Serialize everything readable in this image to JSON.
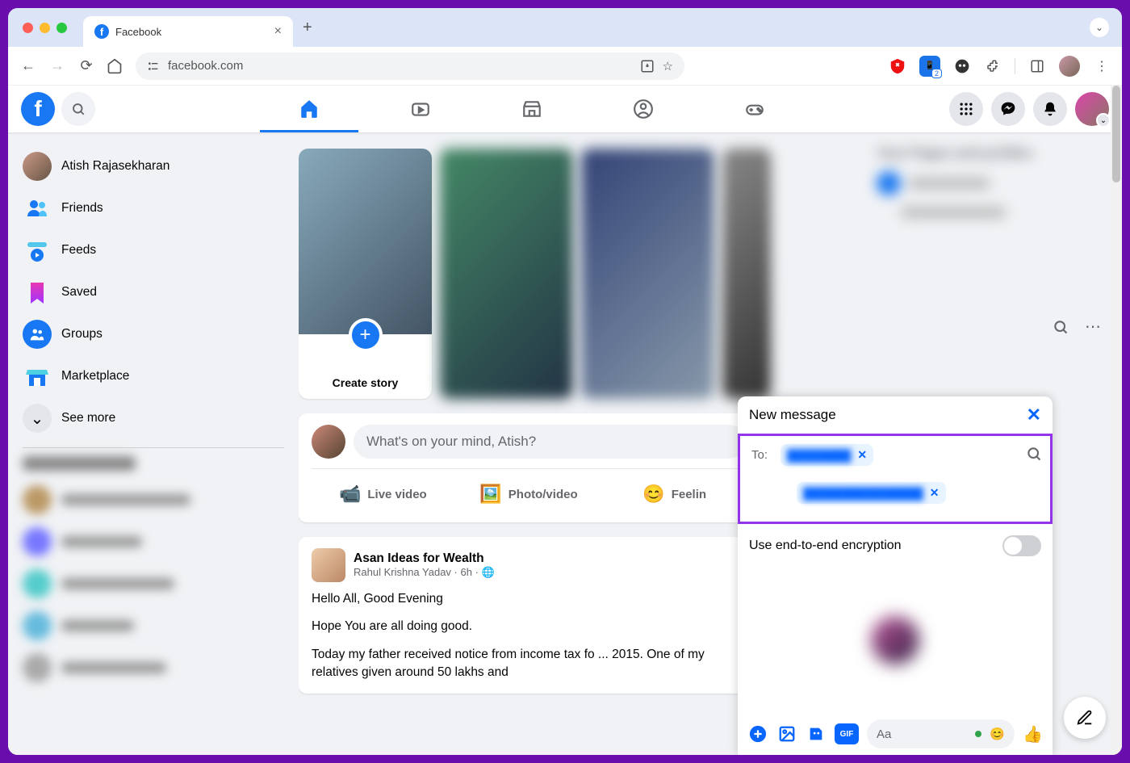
{
  "browser": {
    "tab_title": "Facebook",
    "url": "facebook.com",
    "extension_badge": "2"
  },
  "sidebar": {
    "profile_name": "Atish Rajasekharan",
    "items": [
      {
        "label": "Friends"
      },
      {
        "label": "Feeds"
      },
      {
        "label": "Saved"
      },
      {
        "label": "Groups"
      },
      {
        "label": "Marketplace"
      },
      {
        "label": "See more"
      }
    ]
  },
  "stories": {
    "create_label": "Create story"
  },
  "composer": {
    "placeholder": "What's on your mind, Atish?",
    "live_video": "Live video",
    "photo_video": "Photo/video",
    "feeling": "Feelin"
  },
  "post": {
    "page_name": "Asan Ideas for Wealth",
    "author": "Rahul Krishna Yadav",
    "time": "6h",
    "line1": "Hello All, Good Evening",
    "line2": "Hope You are all doing good.",
    "line3": "Today my father received notice from income tax fo ... 2015. One of my relatives given around 50 lakhs and"
  },
  "chat": {
    "title": "New message",
    "to_label": "To:",
    "encryption_label": "Use end-to-end encryption",
    "input_placeholder": "Aa",
    "gif_label": "GIF"
  }
}
